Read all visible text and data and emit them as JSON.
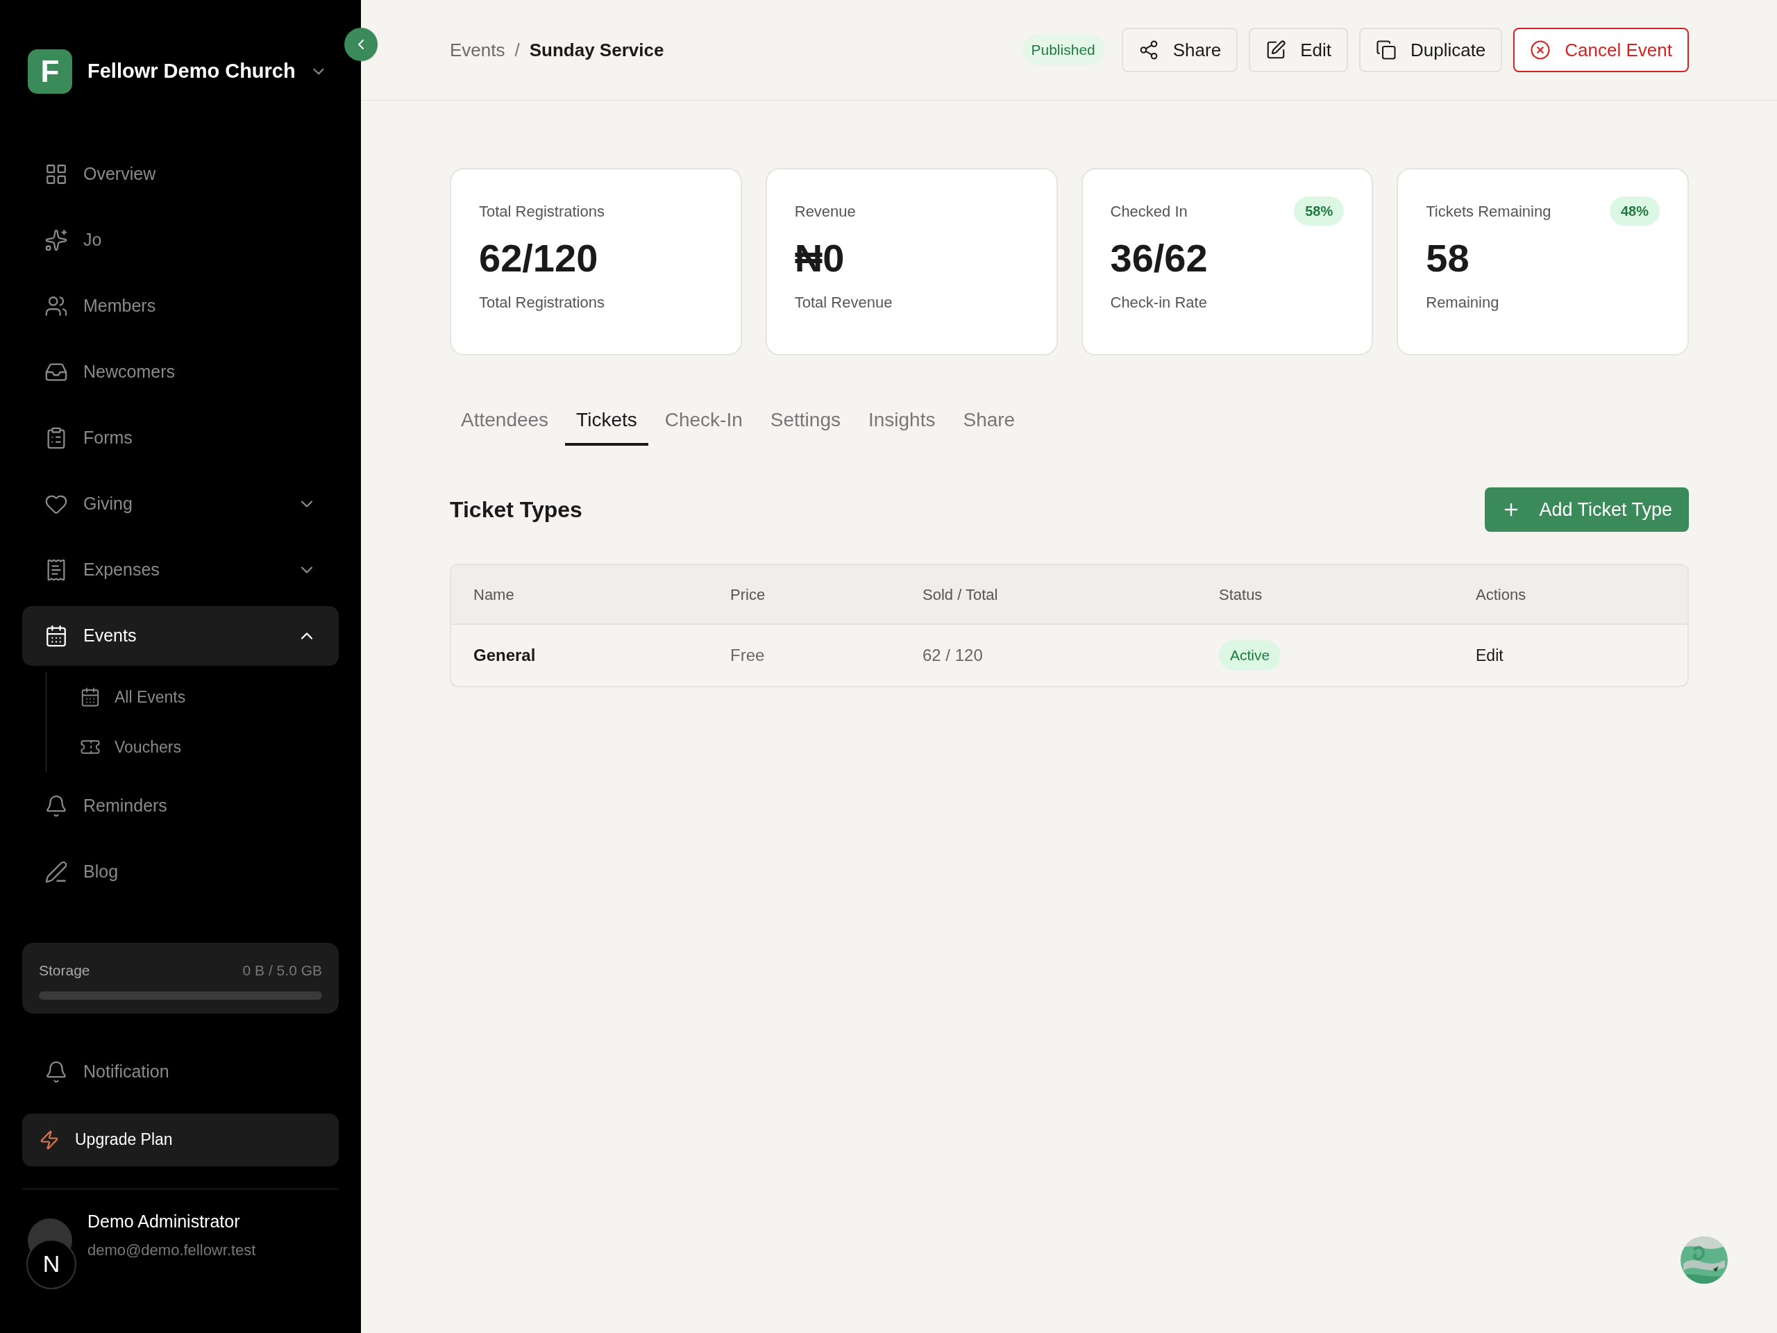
{
  "sidebar": {
    "org_initial": "F",
    "org_name": "Fellowr Demo Church",
    "items": [
      {
        "label": "Overview",
        "selected": false
      },
      {
        "label": "Jo",
        "selected": false
      },
      {
        "label": "Members",
        "selected": false
      },
      {
        "label": "Newcomers",
        "selected": false
      },
      {
        "label": "Forms",
        "selected": false
      },
      {
        "label": "Giving",
        "selected": false,
        "expanded": false
      },
      {
        "label": "Expenses",
        "selected": false,
        "expanded": false
      },
      {
        "label": "Events",
        "selected": true,
        "expanded": true,
        "children": [
          {
            "label": "All Events"
          },
          {
            "label": "Vouchers"
          }
        ]
      },
      {
        "label": "Reminders",
        "selected": false
      },
      {
        "label": "Blog",
        "selected": false
      }
    ],
    "storage": {
      "label": "Storage",
      "reading": "0 B / 5.0 GB",
      "level": 0
    },
    "notification": "Notification",
    "upgrade": "Upgrade Plan",
    "user": {
      "name": "Demo Administrator",
      "email": "demo@demo.fellowr.test"
    },
    "dev_badge": "N"
  },
  "header": {
    "breadcrumb": [
      "Events",
      "Sunday Service"
    ],
    "separator": "/",
    "status": "Published",
    "buttons": [
      {
        "label": "Share",
        "kind": "share"
      },
      {
        "label": "Edit",
        "kind": "edit"
      },
      {
        "label": "Duplicate",
        "kind": "duplicate"
      },
      {
        "label": "Cancel Event",
        "kind": "danger"
      }
    ]
  },
  "stats": [
    {
      "title": "Total Registrations",
      "value": "62/120",
      "caption": "Total Registrations"
    },
    {
      "title": "Revenue",
      "value": "₦0",
      "caption": "Total Revenue"
    },
    {
      "title": "Checked In",
      "badge": "58%",
      "value": "36/62",
      "caption": "Check-in Rate"
    },
    {
      "title": "Tickets Remaining",
      "badge": "48%",
      "value": "58",
      "caption": "Remaining"
    }
  ],
  "tabs": [
    {
      "label": "Attendees",
      "selected": false
    },
    {
      "label": "Tickets",
      "selected": true
    },
    {
      "label": "Check-In",
      "selected": false
    },
    {
      "label": "Settings",
      "selected": false
    },
    {
      "label": "Insights",
      "selected": false
    },
    {
      "label": "Share",
      "selected": false
    }
  ],
  "section": {
    "title": "Ticket Types",
    "button": "Add Ticket Type"
  },
  "table": {
    "columns": [
      "Name",
      "Price",
      "Sold / Total",
      "Status",
      "Actions"
    ],
    "rows": [
      {
        "name": "General",
        "price": "Free",
        "sold": "62 / 120",
        "status": "Active",
        "action": "Edit"
      }
    ]
  }
}
